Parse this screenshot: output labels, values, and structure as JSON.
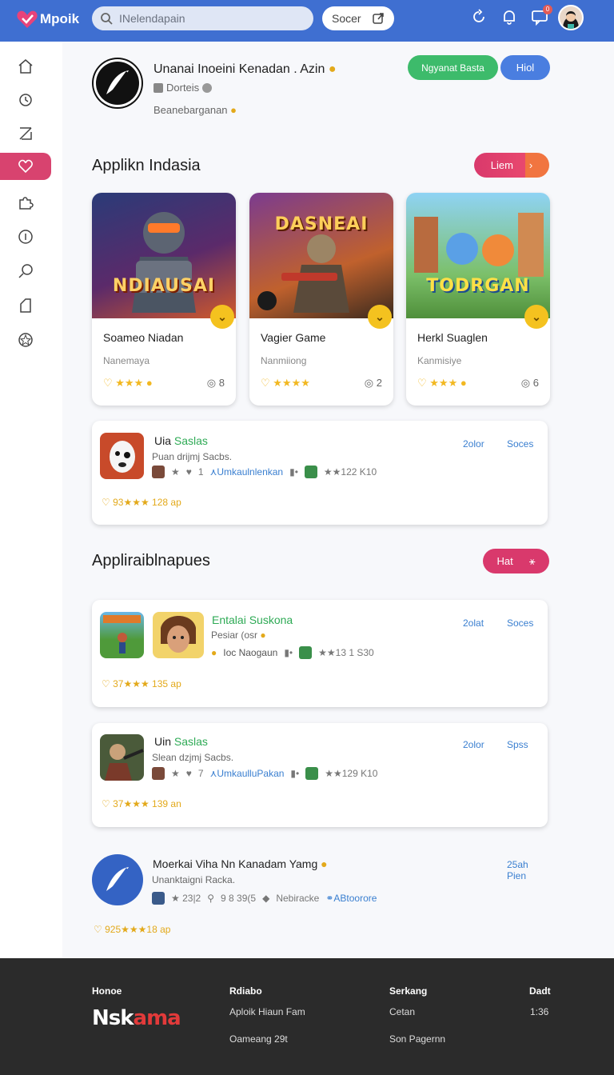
{
  "header": {
    "logo_text": "Mpoik",
    "search_placeholder": "INelendapain",
    "search_button": "Socer"
  },
  "profile": {
    "name": "Unanai Inoeini Kenadan . Azin",
    "sub": "Dorteis",
    "desc": "Beanebarganan"
  },
  "buttons": {
    "primary": "Ngyanat Basta",
    "secondary": "Hiol"
  },
  "sections": [
    {
      "title": "Applikn Indasia",
      "pill": "Liem"
    },
    {
      "title": "Appliraiblnapues",
      "pill": "Hat"
    }
  ],
  "game_cards": [
    {
      "art_title": "NDIAUSAI",
      "name": "Soameo Niadan",
      "dev": "Nanemaya",
      "rating": "★★★",
      "count": "8"
    },
    {
      "art_title": "DASNEAI",
      "name": "Vagier Game",
      "dev": "Nanmiiong",
      "rating": "★★★★",
      "count": "2"
    },
    {
      "art_title": "TODRGAN",
      "name": "Herkl Suaglen",
      "dev": "Kanmisiye",
      "rating": "★★★",
      "count": "6"
    }
  ],
  "list_cards": [
    {
      "title_plain": "Uia ",
      "title_green": "Saslas",
      "sub": "Puan drijmj Sacbs.",
      "meta_count": "1",
      "meta_link": "Umkaulnlenkan",
      "meta_stat": "★★122 K10",
      "rating": "93★★★ 128 ap",
      "link1": "2olor",
      "link2": "Soces"
    },
    {
      "title_plain": "",
      "title_green": "Entalai Suskona",
      "sub": "Pesiar (osr",
      "meta_link": "Ioc Naogaun",
      "meta_stat": "★★13 1 S30",
      "rating": "37★★★ 135 ap",
      "link1": "2olat",
      "link2": "Soces"
    },
    {
      "title_plain": "Uin ",
      "title_green": "Saslas",
      "sub": "Slean dzjmj Sacbs.",
      "meta_count": "7",
      "meta_link": "UmkaulluPakan",
      "meta_stat": "★★129 K10",
      "rating": "37★★★ 139 an",
      "link1": "2olor",
      "link2": "Spss"
    },
    {
      "title": "Moerkai Viha Nn Kanadam Yamg",
      "sub": "Unanktaigni Racka.",
      "meta_stat1": "★ 23|2",
      "meta_stat2": "9 8 39(5",
      "meta_link1": "Nebiracke",
      "meta_link2": "ABtoorore",
      "rating": "925★★★18 ap",
      "link1": "25ah Pien"
    }
  ],
  "footer": {
    "col1_head": "Honoe",
    "brand_white": "Nsk",
    "brand_red": "ama",
    "col2_head": "Rdiabo",
    "col2_items": [
      "Aploik Hiaun Fam",
      "Oameang 29t"
    ],
    "col3_head": "Serkang",
    "col3_items": [
      "Cetan",
      "Son Pagernn"
    ],
    "col4_head": "Dadt",
    "col4_items": [
      "1:36"
    ]
  },
  "colors": {
    "header_bg": "#3f6fd1",
    "accent_pink": "#d9396c",
    "green": "#3dbb6b",
    "blue": "#4a7ee0",
    "star": "#f2b821"
  }
}
